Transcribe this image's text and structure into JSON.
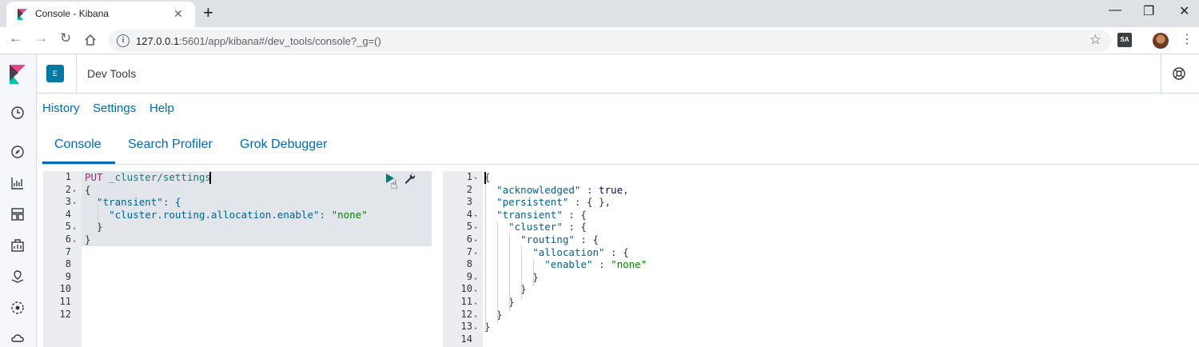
{
  "browser": {
    "tab_title": "Console - Kibana",
    "tab_close": "✕",
    "new_tab": "+",
    "url_host": "127.0.0.1",
    "url_rest": ":5601/app/kibana#/dev_tools/console?_g=()",
    "extension_label": "SA",
    "window_controls": [
      "—",
      "❐",
      "✕"
    ]
  },
  "header": {
    "space_initial": "E",
    "title": "Dev Tools"
  },
  "top_nav": [
    "History",
    "Settings",
    "Help"
  ],
  "tabs": [
    "Console",
    "Search Profiler",
    "Grok Debugger"
  ],
  "request_editor": {
    "line_numbers": [
      "1",
      "2",
      "3",
      "4",
      "5",
      "6",
      "7",
      "8",
      "9",
      "10",
      "11",
      "12"
    ],
    "fold_markers": [
      "",
      "▾",
      "▾",
      "",
      "▴",
      "▴",
      "",
      "",
      "",
      "",
      "",
      ""
    ],
    "method": "PUT",
    "path": "_cluster/settings",
    "lines": [
      "{",
      "  \"transient\": {",
      "    \"cluster.routing.allocation.enable\": \"none\"",
      "  }",
      "}"
    ]
  },
  "response_editor": {
    "line_numbers": [
      "1",
      "2",
      "3",
      "4",
      "5",
      "6",
      "7",
      "8",
      "9",
      "10",
      "11",
      "12",
      "13",
      "14"
    ],
    "fold_markers": [
      "▾",
      "",
      "",
      "▾",
      "▾",
      "▾",
      "▾",
      "",
      "▴",
      "▴",
      "▴",
      "▴",
      "▴",
      ""
    ],
    "lines": [
      "{",
      "  \"acknowledged\" : true,",
      "  \"persistent\" : { },",
      "  \"transient\" : {",
      "    \"cluster\" : {",
      "      \"routing\" : {",
      "        \"allocation\" : {",
      "          \"enable\" : \"none\"",
      "        }",
      "      }",
      "    }",
      "  }",
      "}"
    ]
  },
  "colors": {
    "link": "#006bb4",
    "method": "#b11f7f",
    "string": "#008000",
    "key": "#006090"
  }
}
